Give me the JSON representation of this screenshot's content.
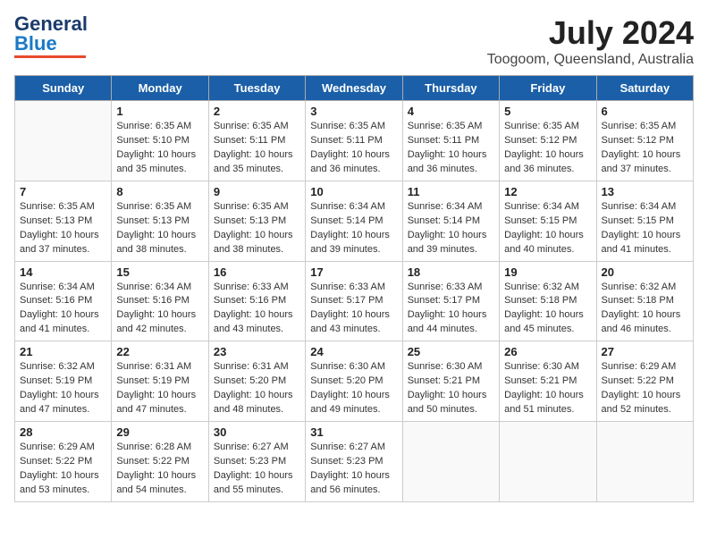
{
  "logo": {
    "general": "General",
    "blue": "Blue"
  },
  "title": "July 2024",
  "subtitle": "Toogoom, Queensland, Australia",
  "days_of_week": [
    "Sunday",
    "Monday",
    "Tuesday",
    "Wednesday",
    "Thursday",
    "Friday",
    "Saturday"
  ],
  "weeks": [
    [
      {
        "day": "",
        "sunrise": "",
        "sunset": "",
        "daylight": ""
      },
      {
        "day": "1",
        "sunrise": "Sunrise: 6:35 AM",
        "sunset": "Sunset: 5:10 PM",
        "daylight": "Daylight: 10 hours and 35 minutes."
      },
      {
        "day": "2",
        "sunrise": "Sunrise: 6:35 AM",
        "sunset": "Sunset: 5:11 PM",
        "daylight": "Daylight: 10 hours and 35 minutes."
      },
      {
        "day": "3",
        "sunrise": "Sunrise: 6:35 AM",
        "sunset": "Sunset: 5:11 PM",
        "daylight": "Daylight: 10 hours and 36 minutes."
      },
      {
        "day": "4",
        "sunrise": "Sunrise: 6:35 AM",
        "sunset": "Sunset: 5:11 PM",
        "daylight": "Daylight: 10 hours and 36 minutes."
      },
      {
        "day": "5",
        "sunrise": "Sunrise: 6:35 AM",
        "sunset": "Sunset: 5:12 PM",
        "daylight": "Daylight: 10 hours and 36 minutes."
      },
      {
        "day": "6",
        "sunrise": "Sunrise: 6:35 AM",
        "sunset": "Sunset: 5:12 PM",
        "daylight": "Daylight: 10 hours and 37 minutes."
      }
    ],
    [
      {
        "day": "7",
        "sunrise": "Sunrise: 6:35 AM",
        "sunset": "Sunset: 5:13 PM",
        "daylight": "Daylight: 10 hours and 37 minutes."
      },
      {
        "day": "8",
        "sunrise": "Sunrise: 6:35 AM",
        "sunset": "Sunset: 5:13 PM",
        "daylight": "Daylight: 10 hours and 38 minutes."
      },
      {
        "day": "9",
        "sunrise": "Sunrise: 6:35 AM",
        "sunset": "Sunset: 5:13 PM",
        "daylight": "Daylight: 10 hours and 38 minutes."
      },
      {
        "day": "10",
        "sunrise": "Sunrise: 6:34 AM",
        "sunset": "Sunset: 5:14 PM",
        "daylight": "Daylight: 10 hours and 39 minutes."
      },
      {
        "day": "11",
        "sunrise": "Sunrise: 6:34 AM",
        "sunset": "Sunset: 5:14 PM",
        "daylight": "Daylight: 10 hours and 39 minutes."
      },
      {
        "day": "12",
        "sunrise": "Sunrise: 6:34 AM",
        "sunset": "Sunset: 5:15 PM",
        "daylight": "Daylight: 10 hours and 40 minutes."
      },
      {
        "day": "13",
        "sunrise": "Sunrise: 6:34 AM",
        "sunset": "Sunset: 5:15 PM",
        "daylight": "Daylight: 10 hours and 41 minutes."
      }
    ],
    [
      {
        "day": "14",
        "sunrise": "Sunrise: 6:34 AM",
        "sunset": "Sunset: 5:16 PM",
        "daylight": "Daylight: 10 hours and 41 minutes."
      },
      {
        "day": "15",
        "sunrise": "Sunrise: 6:34 AM",
        "sunset": "Sunset: 5:16 PM",
        "daylight": "Daylight: 10 hours and 42 minutes."
      },
      {
        "day": "16",
        "sunrise": "Sunrise: 6:33 AM",
        "sunset": "Sunset: 5:16 PM",
        "daylight": "Daylight: 10 hours and 43 minutes."
      },
      {
        "day": "17",
        "sunrise": "Sunrise: 6:33 AM",
        "sunset": "Sunset: 5:17 PM",
        "daylight": "Daylight: 10 hours and 43 minutes."
      },
      {
        "day": "18",
        "sunrise": "Sunrise: 6:33 AM",
        "sunset": "Sunset: 5:17 PM",
        "daylight": "Daylight: 10 hours and 44 minutes."
      },
      {
        "day": "19",
        "sunrise": "Sunrise: 6:32 AM",
        "sunset": "Sunset: 5:18 PM",
        "daylight": "Daylight: 10 hours and 45 minutes."
      },
      {
        "day": "20",
        "sunrise": "Sunrise: 6:32 AM",
        "sunset": "Sunset: 5:18 PM",
        "daylight": "Daylight: 10 hours and 46 minutes."
      }
    ],
    [
      {
        "day": "21",
        "sunrise": "Sunrise: 6:32 AM",
        "sunset": "Sunset: 5:19 PM",
        "daylight": "Daylight: 10 hours and 47 minutes."
      },
      {
        "day": "22",
        "sunrise": "Sunrise: 6:31 AM",
        "sunset": "Sunset: 5:19 PM",
        "daylight": "Daylight: 10 hours and 47 minutes."
      },
      {
        "day": "23",
        "sunrise": "Sunrise: 6:31 AM",
        "sunset": "Sunset: 5:20 PM",
        "daylight": "Daylight: 10 hours and 48 minutes."
      },
      {
        "day": "24",
        "sunrise": "Sunrise: 6:30 AM",
        "sunset": "Sunset: 5:20 PM",
        "daylight": "Daylight: 10 hours and 49 minutes."
      },
      {
        "day": "25",
        "sunrise": "Sunrise: 6:30 AM",
        "sunset": "Sunset: 5:21 PM",
        "daylight": "Daylight: 10 hours and 50 minutes."
      },
      {
        "day": "26",
        "sunrise": "Sunrise: 6:30 AM",
        "sunset": "Sunset: 5:21 PM",
        "daylight": "Daylight: 10 hours and 51 minutes."
      },
      {
        "day": "27",
        "sunrise": "Sunrise: 6:29 AM",
        "sunset": "Sunset: 5:22 PM",
        "daylight": "Daylight: 10 hours and 52 minutes."
      }
    ],
    [
      {
        "day": "28",
        "sunrise": "Sunrise: 6:29 AM",
        "sunset": "Sunset: 5:22 PM",
        "daylight": "Daylight: 10 hours and 53 minutes."
      },
      {
        "day": "29",
        "sunrise": "Sunrise: 6:28 AM",
        "sunset": "Sunset: 5:22 PM",
        "daylight": "Daylight: 10 hours and 54 minutes."
      },
      {
        "day": "30",
        "sunrise": "Sunrise: 6:27 AM",
        "sunset": "Sunset: 5:23 PM",
        "daylight": "Daylight: 10 hours and 55 minutes."
      },
      {
        "day": "31",
        "sunrise": "Sunrise: 6:27 AM",
        "sunset": "Sunset: 5:23 PM",
        "daylight": "Daylight: 10 hours and 56 minutes."
      },
      {
        "day": "",
        "sunrise": "",
        "sunset": "",
        "daylight": ""
      },
      {
        "day": "",
        "sunrise": "",
        "sunset": "",
        "daylight": ""
      },
      {
        "day": "",
        "sunrise": "",
        "sunset": "",
        "daylight": ""
      }
    ]
  ]
}
